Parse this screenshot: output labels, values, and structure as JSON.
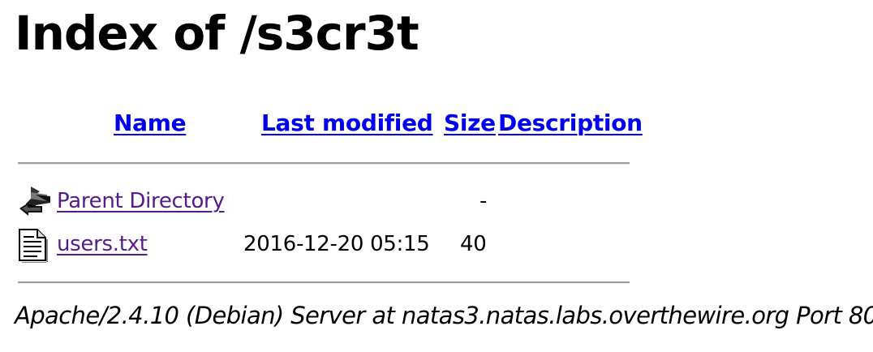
{
  "page": {
    "title": "Index of /s3cr3t"
  },
  "table": {
    "headers": {
      "name": "Name",
      "last_modified": "Last modified",
      "size": "Size",
      "description": "Description"
    },
    "rows": [
      {
        "icon": "back-arrow-icon",
        "name": "Parent Directory",
        "last_modified": "",
        "size": "-",
        "description": ""
      },
      {
        "icon": "text-file-icon",
        "name": "users.txt",
        "last_modified": "2016-12-20 05:15",
        "size": "40",
        "description": ""
      }
    ]
  },
  "footer": {
    "server_signature": "Apache/2.4.10 (Debian) Server at natas3.natas.labs.overthewire.org Port 80"
  },
  "colors": {
    "link": "#0000ee",
    "visited_link": "#551a8b",
    "rule": "#9a9a9a"
  }
}
